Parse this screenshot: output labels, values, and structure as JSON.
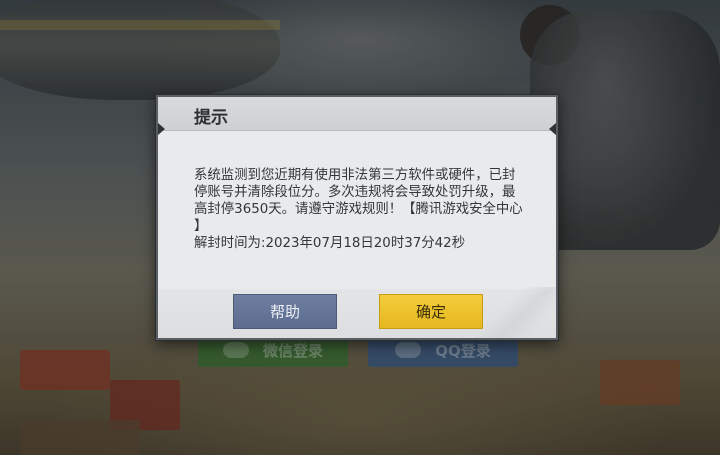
{
  "dialog": {
    "title": "提示",
    "message_line1": "系统监测到您近期有使用非法第三方软件或硬件，已封",
    "message_line2": "停账号并清除段位分。多次违规将会导致处罚升级，最",
    "message_line3": "高封停3650天。请遵守游戏规则！【腾讯游戏安全中心",
    "message_line4": "】",
    "unban_time": "解封时间为:2023年07月18日20时37分42秒",
    "help_button": "帮助",
    "ok_button": "确定"
  },
  "background": {
    "login_wechat_label": "微信登录",
    "login_qq_label": "QQ登录"
  },
  "colors": {
    "dialog_bg": "#e9eaeb",
    "help_button": "#6e7ea0",
    "ok_button": "#f3cc3c"
  }
}
